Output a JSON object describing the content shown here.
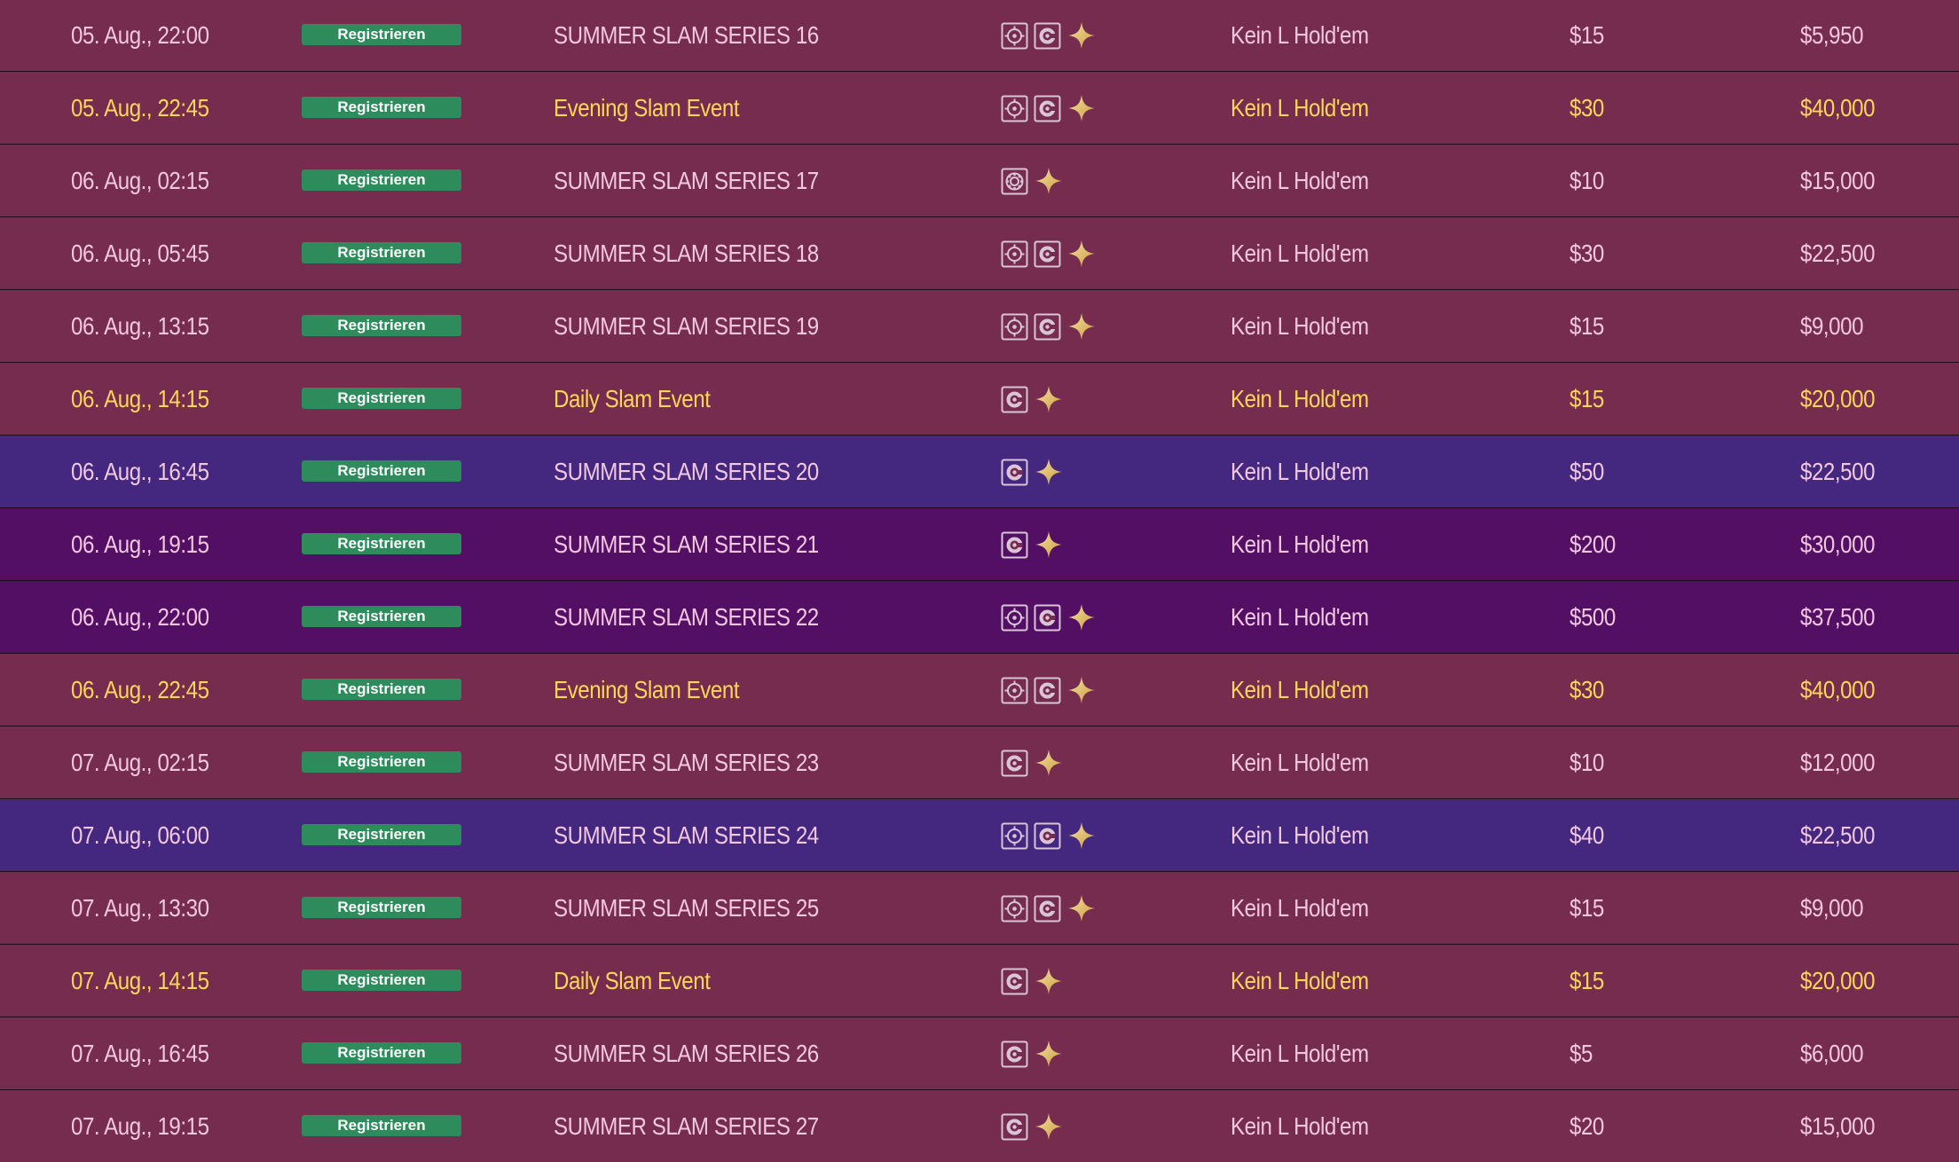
{
  "colors": {
    "row_default": "#762c4e",
    "row_blue": "#44287f",
    "row_purple": "#530f63",
    "text_default": "#f1c8df",
    "text_featured": "#ffd65a",
    "register_button": "#2e8b5c",
    "sparkle": "#e7c86c"
  },
  "rows": [
    {
      "date": "05. Aug., 22:00",
      "register_label": "Registrieren",
      "name": "SUMMER SLAM SERIES 16",
      "game": "Kein L Hold'em",
      "buyin": "$15",
      "prize": "$5,950",
      "icons": [
        "target-icon",
        "bounty-icon",
        "sparkle-icon"
      ],
      "featured": false,
      "bg": "default"
    },
    {
      "date": "05. Aug., 22:45",
      "register_label": "Registrieren",
      "name": "Evening Slam Event",
      "game": "Kein L Hold'em",
      "buyin": "$30",
      "prize": "$40,000",
      "icons": [
        "target-icon",
        "bounty-icon",
        "sparkle-icon"
      ],
      "featured": true,
      "bg": "default"
    },
    {
      "date": "06. Aug., 02:15",
      "register_label": "Registrieren",
      "name": "SUMMER SLAM SERIES 17",
      "game": "Kein L Hold'em",
      "buyin": "$10",
      "prize": "$15,000",
      "icons": [
        "chip-icon",
        "sparkle-icon"
      ],
      "featured": false,
      "bg": "default"
    },
    {
      "date": "06. Aug., 05:45",
      "register_label": "Registrieren",
      "name": "SUMMER SLAM SERIES 18",
      "game": "Kein L Hold'em",
      "buyin": "$30",
      "prize": "$22,500",
      "icons": [
        "target-icon",
        "bounty-icon",
        "sparkle-icon"
      ],
      "featured": false,
      "bg": "default"
    },
    {
      "date": "06. Aug., 13:15",
      "register_label": "Registrieren",
      "name": "SUMMER SLAM SERIES 19",
      "game": "Kein L Hold'em",
      "buyin": "$15",
      "prize": "$9,000",
      "icons": [
        "target-icon",
        "bounty-icon",
        "sparkle-icon"
      ],
      "featured": false,
      "bg": "default"
    },
    {
      "date": "06. Aug., 14:15",
      "register_label": "Registrieren",
      "name": "Daily Slam Event",
      "game": "Kein L Hold'em",
      "buyin": "$15",
      "prize": "$20,000",
      "icons": [
        "bounty-icon",
        "sparkle-icon"
      ],
      "featured": true,
      "bg": "default"
    },
    {
      "date": "06. Aug., 16:45",
      "register_label": "Registrieren",
      "name": "SUMMER SLAM SERIES 20",
      "game": "Kein L Hold'em",
      "buyin": "$50",
      "prize": "$22,500",
      "icons": [
        "bounty-icon",
        "sparkle-icon"
      ],
      "featured": false,
      "bg": "blue"
    },
    {
      "date": "06. Aug., 19:15",
      "register_label": "Registrieren",
      "name": "SUMMER SLAM SERIES 21",
      "game": "Kein L Hold'em",
      "buyin": "$200",
      "prize": "$30,000",
      "icons": [
        "bounty-icon",
        "sparkle-icon"
      ],
      "featured": false,
      "bg": "purple"
    },
    {
      "date": "06. Aug., 22:00",
      "register_label": "Registrieren",
      "name": "SUMMER SLAM SERIES 22",
      "game": "Kein L Hold'em",
      "buyin": "$500",
      "prize": "$37,500",
      "icons": [
        "target-icon",
        "bounty-icon",
        "sparkle-icon"
      ],
      "featured": false,
      "bg": "purple"
    },
    {
      "date": "06. Aug., 22:45",
      "register_label": "Registrieren",
      "name": "Evening Slam Event",
      "game": "Kein L Hold'em",
      "buyin": "$30",
      "prize": "$40,000",
      "icons": [
        "target-icon",
        "bounty-icon",
        "sparkle-icon"
      ],
      "featured": true,
      "bg": "default"
    },
    {
      "date": "07. Aug., 02:15",
      "register_label": "Registrieren",
      "name": "SUMMER SLAM SERIES 23",
      "game": "Kein L Hold'em",
      "buyin": "$10",
      "prize": "$12,000",
      "icons": [
        "bounty-icon",
        "sparkle-icon"
      ],
      "featured": false,
      "bg": "default"
    },
    {
      "date": "07. Aug., 06:00",
      "register_label": "Registrieren",
      "name": "SUMMER SLAM SERIES 24",
      "game": "Kein L Hold'em",
      "buyin": "$40",
      "prize": "$22,500",
      "icons": [
        "target-icon",
        "bounty-icon",
        "sparkle-icon"
      ],
      "featured": false,
      "bg": "blue"
    },
    {
      "date": "07. Aug., 13:30",
      "register_label": "Registrieren",
      "name": "SUMMER SLAM SERIES 25",
      "game": "Kein L Hold'em",
      "buyin": "$15",
      "prize": "$9,000",
      "icons": [
        "target-icon",
        "bounty-icon",
        "sparkle-icon"
      ],
      "featured": false,
      "bg": "default"
    },
    {
      "date": "07. Aug., 14:15",
      "register_label": "Registrieren",
      "name": "Daily Slam Event",
      "game": "Kein L Hold'em",
      "buyin": "$15",
      "prize": "$20,000",
      "icons": [
        "bounty-icon",
        "sparkle-icon"
      ],
      "featured": true,
      "bg": "default"
    },
    {
      "date": "07. Aug., 16:45",
      "register_label": "Registrieren",
      "name": "SUMMER SLAM SERIES 26",
      "game": "Kein L Hold'em",
      "buyin": "$5",
      "prize": "$6,000",
      "icons": [
        "bounty-icon",
        "sparkle-icon"
      ],
      "featured": false,
      "bg": "default"
    },
    {
      "date": "07. Aug., 19:15",
      "register_label": "Registrieren",
      "name": "SUMMER SLAM SERIES 27",
      "game": "Kein L Hold'em",
      "buyin": "$20",
      "prize": "$15,000",
      "icons": [
        "bounty-icon",
        "sparkle-icon"
      ],
      "featured": false,
      "bg": "default"
    }
  ]
}
